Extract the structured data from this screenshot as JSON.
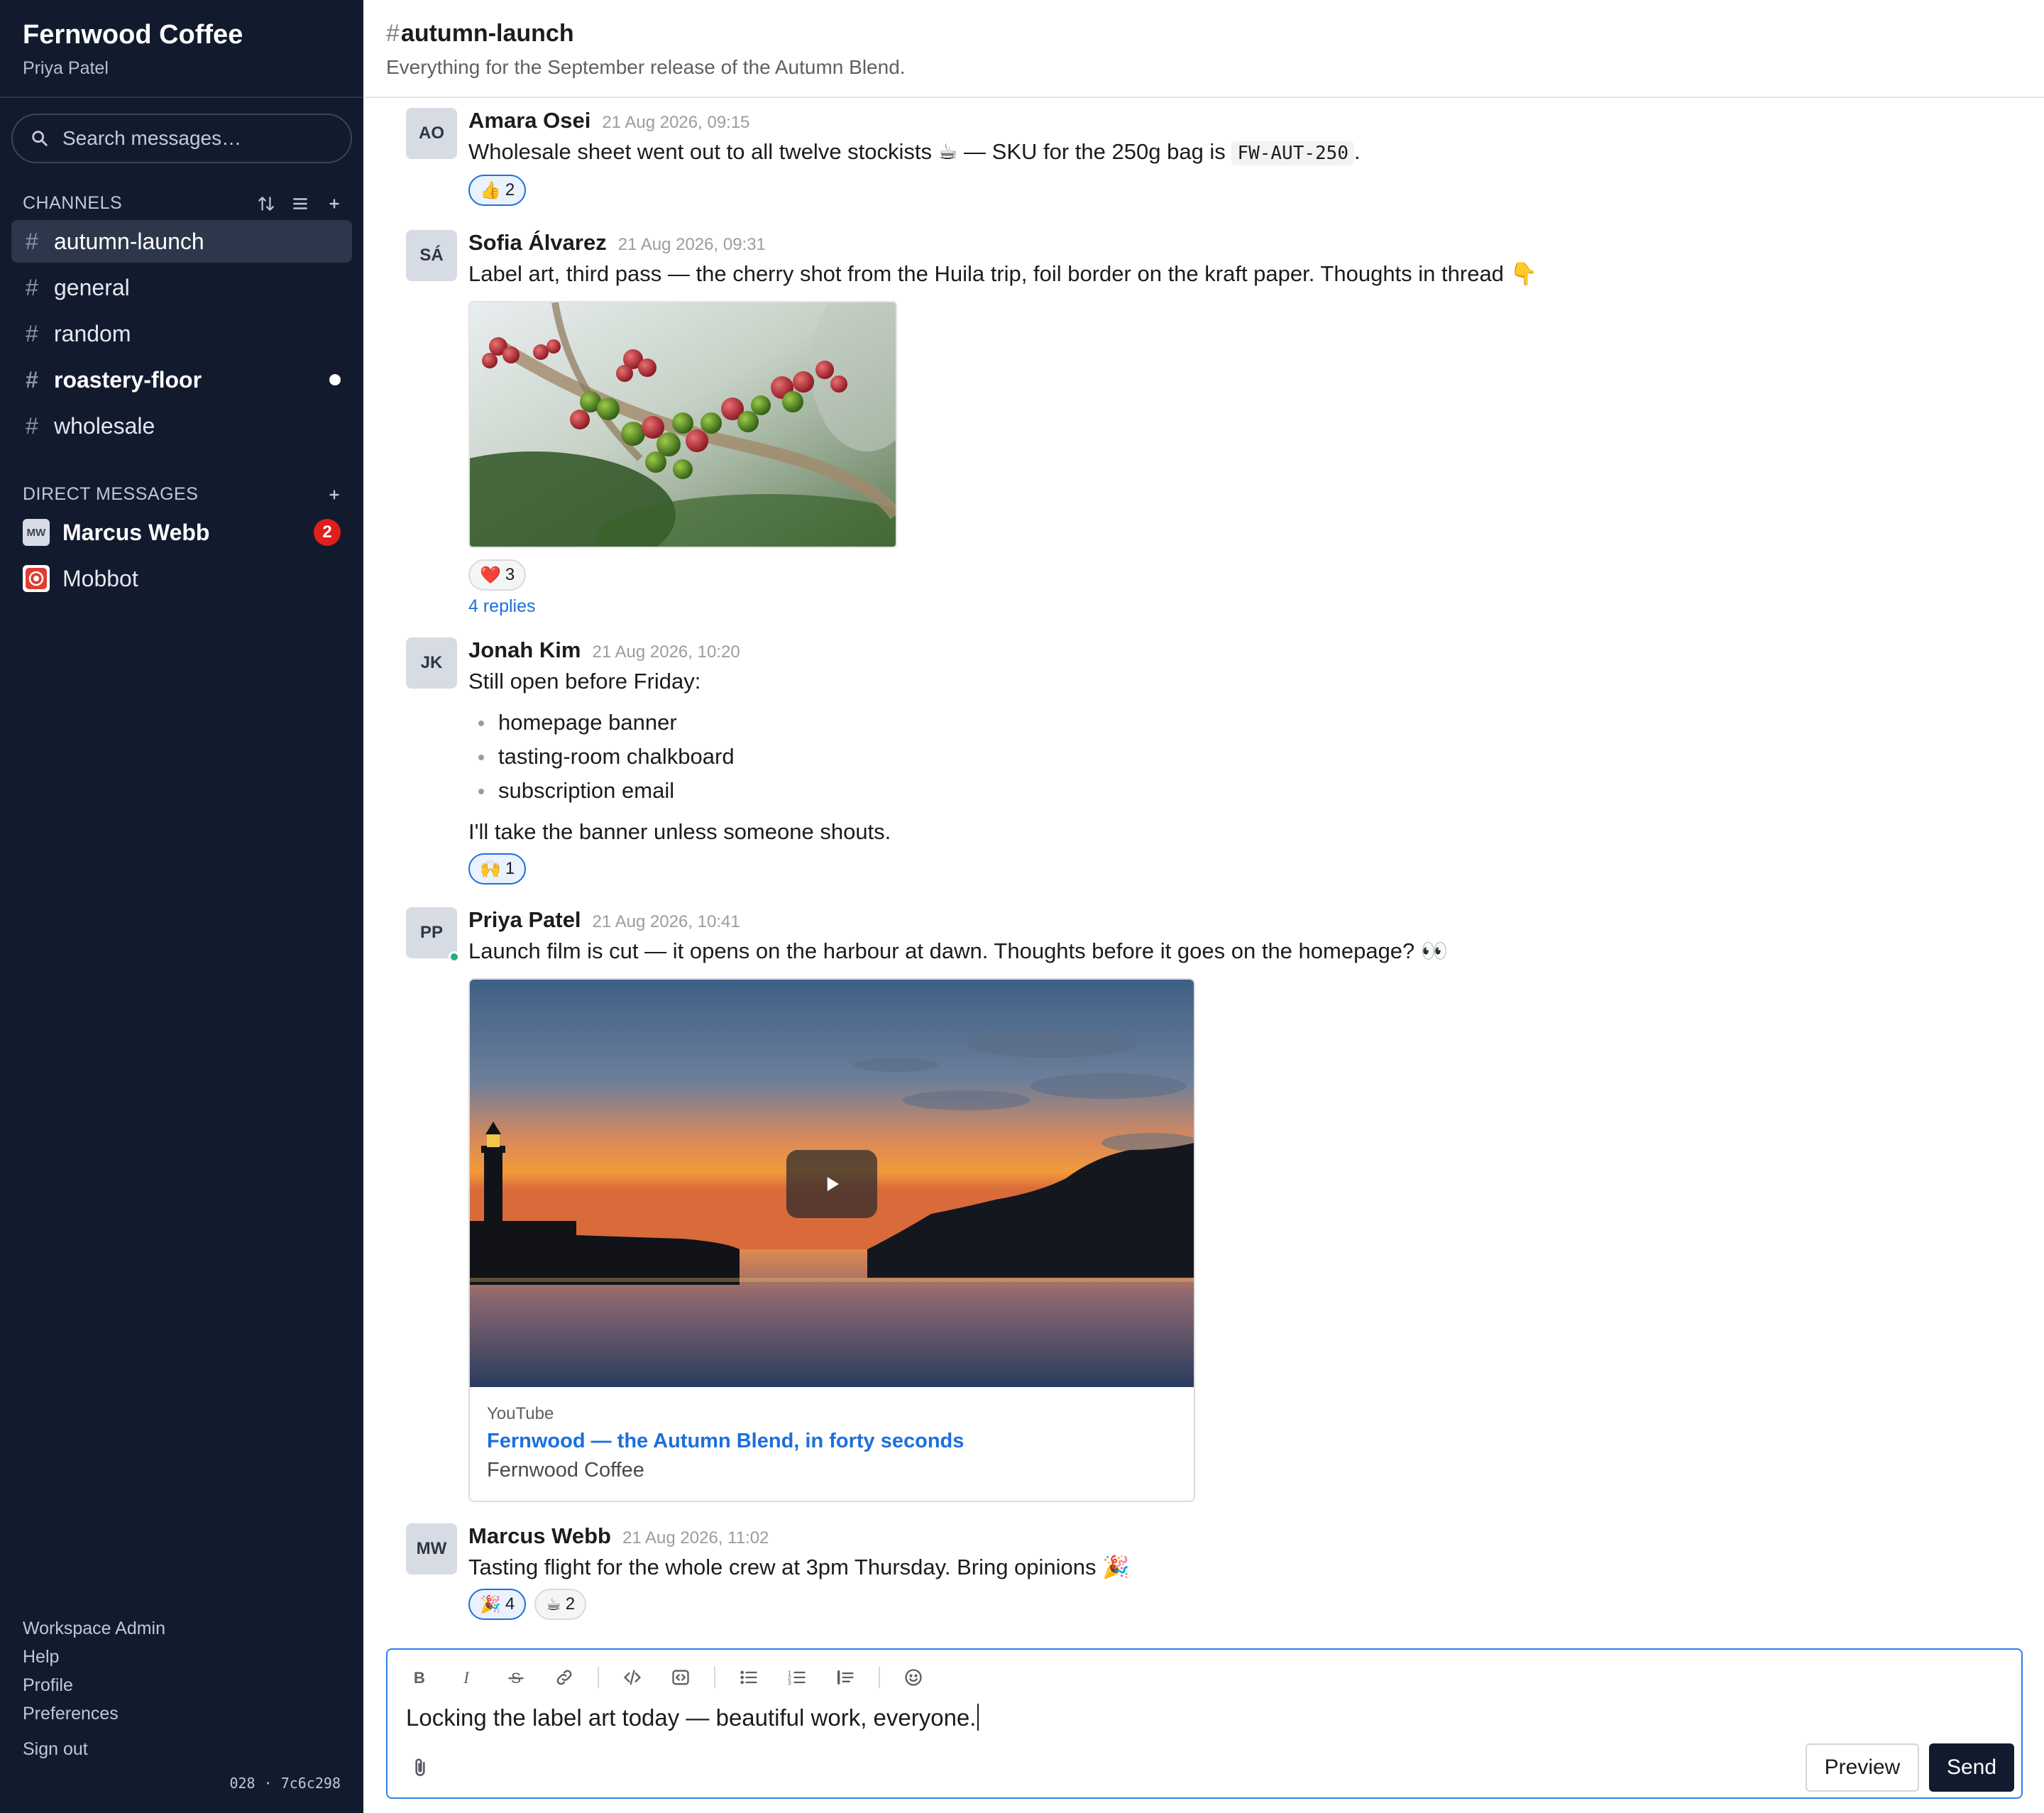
{
  "workspace": {
    "name": "Fernwood Coffee",
    "user": "Priya Patel"
  },
  "search": {
    "placeholder": "Search messages…"
  },
  "channels_section": {
    "label": "CHANNELS"
  },
  "channels": [
    {
      "name": "autumn-launch",
      "active": true
    },
    {
      "name": "general"
    },
    {
      "name": "random"
    },
    {
      "name": "roastery-floor",
      "unread": true
    },
    {
      "name": "wholesale"
    }
  ],
  "dm_section": {
    "label": "DIRECT MESSAGES"
  },
  "dms": [
    {
      "name": "Marcus Webb",
      "initials": "MW",
      "badge": "2"
    },
    {
      "name": "Mobbot"
    }
  ],
  "footer": {
    "links": [
      "Workspace Admin",
      "Help",
      "Profile",
      "Preferences"
    ],
    "signout": "Sign out",
    "build": "028 · 7c6c298"
  },
  "channel_header": {
    "hash": "#",
    "name": "autumn-launch",
    "description": "Everything for the September release of the Autumn Blend."
  },
  "messages": [
    {
      "initials": "AO",
      "author": "Amara Osei",
      "time": "21 Aug 2026, 09:15",
      "text_before": "Wholesale sheet went out to all twelve stockists ☕ — SKU for the 250g bag is",
      "code": "FW-AUT-250",
      "text_after": ".",
      "reactions": [
        {
          "emoji": "👍",
          "count": "2"
        }
      ]
    },
    {
      "initials": "SÁ",
      "author": "Sofia Álvarez",
      "time": "21 Aug 2026, 09:31",
      "text": "Label art, third pass — the cherry shot from the Huila trip, foil border on the kraft paper. Thoughts in thread 👇",
      "reactions": [
        {
          "emoji": "❤️",
          "count": "3"
        }
      ],
      "replies": "4 replies"
    },
    {
      "initials": "JK",
      "author": "Jonah Kim",
      "time": "21 Aug 2026, 10:20",
      "text": "Still open before Friday:",
      "bullets": [
        "homepage banner",
        "tasting-room chalkboard",
        "subscription email"
      ],
      "text2": "I'll take the banner unless someone shouts.",
      "reactions": [
        {
          "emoji": "🙌",
          "count": "1"
        }
      ]
    },
    {
      "initials": "PP",
      "author": "Priya Patel",
      "time": "21 Aug 2026, 10:41",
      "text": "Launch film is cut — it opens on the harbour at dawn. Thoughts before it goes on the homepage? 👀",
      "video": {
        "source": "YouTube",
        "title": "Fernwood — the Autumn Blend, in forty seconds",
        "channel": "Fernwood Coffee"
      }
    },
    {
      "initials": "MW",
      "author": "Marcus Webb",
      "time": "21 Aug 2026, 11:02",
      "text": "Tasting flight for the whole crew at 3pm Thursday. Bring opinions 🎉",
      "reactions": [
        {
          "emoji": "🎉",
          "count": "4"
        },
        {
          "emoji": "☕",
          "count": "2"
        }
      ]
    }
  ],
  "composer": {
    "draft": "Locking the label art today — beautiful work, everyone.",
    "preview_label": "Preview",
    "send_label": "Send"
  },
  "colors": {
    "sidebar_bg": "#121b2e",
    "accent_link": "#1d6fdc",
    "badge_red": "#e01e1e",
    "presence_green": "#2bac76"
  }
}
